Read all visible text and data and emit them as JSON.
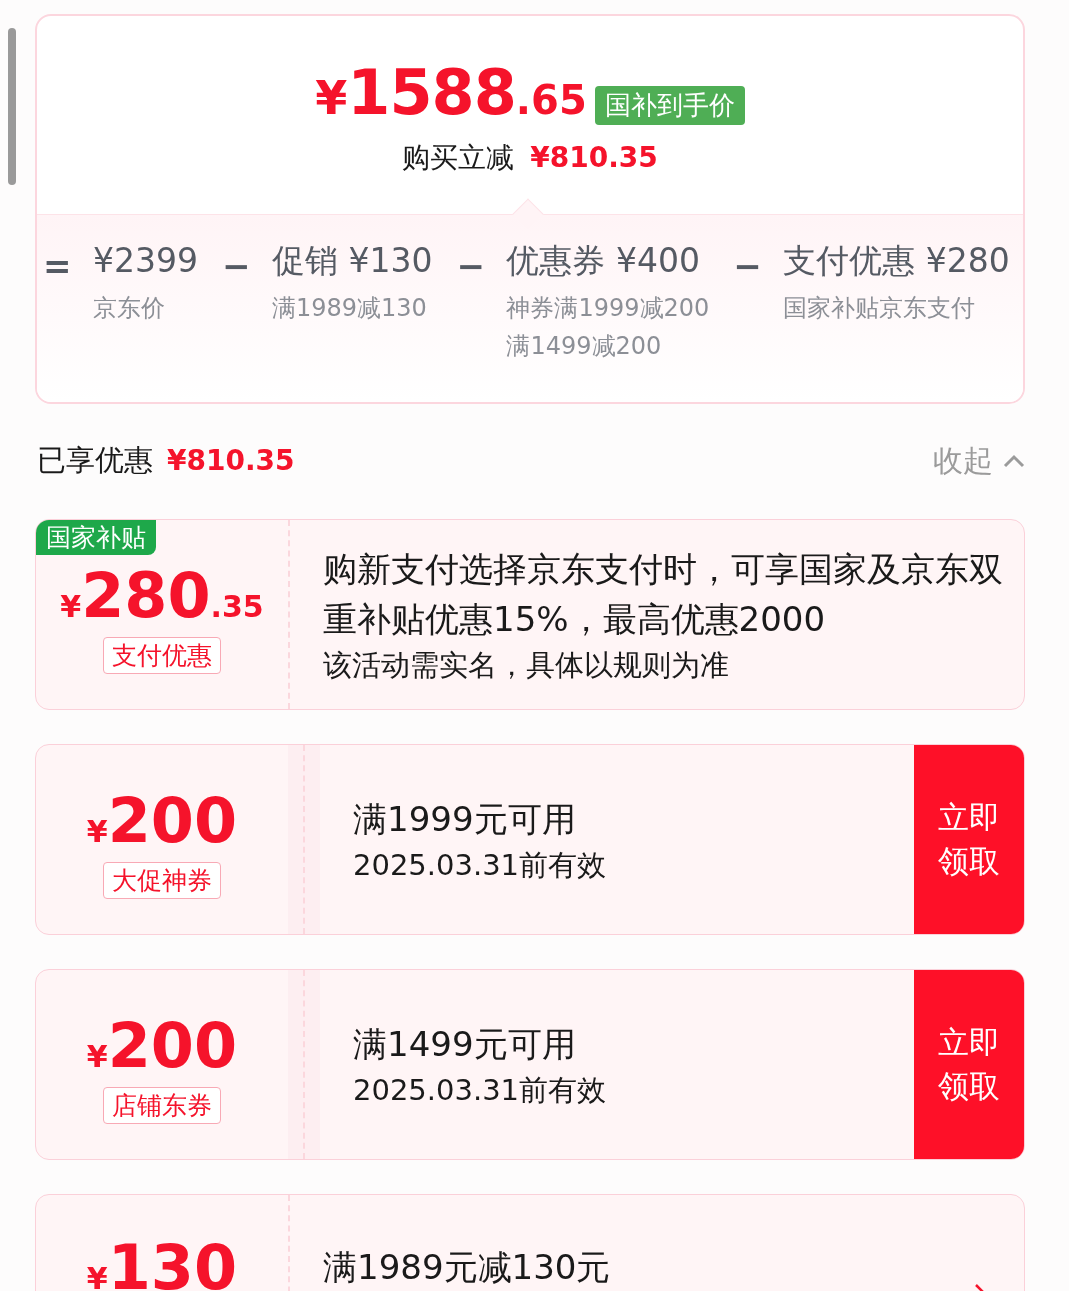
{
  "summary": {
    "currency": "¥",
    "price_integer": "1588",
    "price_decimal": ".65",
    "badge": "国补到手价",
    "saving_label": "购买立减",
    "saving_amount": "¥810.35"
  },
  "breakdown": [
    {
      "operator": "=",
      "amount": "¥2399",
      "notes": [
        "京东价"
      ]
    },
    {
      "operator": "−",
      "title": "促销",
      "amount": "¥130",
      "notes": [
        "满1989减130"
      ]
    },
    {
      "operator": "−",
      "title": "优惠券",
      "amount": "¥400",
      "notes": [
        "神券满1999减200",
        "满1499减200"
      ]
    },
    {
      "operator": "−",
      "title": "支付优惠",
      "amount": "¥280",
      "notes": [
        "国家补贴京东支付"
      ]
    }
  ],
  "enjoyed": {
    "label": "已享优惠",
    "amount": "¥810.35",
    "toggle": "收起"
  },
  "offers": [
    {
      "kind": "subsidy",
      "tag": "国家补贴",
      "currency": "¥",
      "amount": "280",
      "decimal": ".35",
      "type_label": "支付优惠",
      "title": "购新支付选择京东支付时，可享国家及京东双重补贴优惠15%，最高优惠2000",
      "subtitle": "该活动需实名，具体以规则为准"
    },
    {
      "kind": "coupon",
      "currency": "¥",
      "amount": "200",
      "type_label": "大促神券",
      "title": "满1999元可用",
      "subtitle": "2025.03.31前有效",
      "action": "立即领取"
    },
    {
      "kind": "coupon",
      "currency": "¥",
      "amount": "200",
      "type_label": "店铺东券",
      "title": "满1499元可用",
      "subtitle": "2025.03.31前有效",
      "action": "立即领取"
    },
    {
      "kind": "promo",
      "currency": "¥",
      "amount": "130",
      "title": "满1989元减130元"
    }
  ]
}
